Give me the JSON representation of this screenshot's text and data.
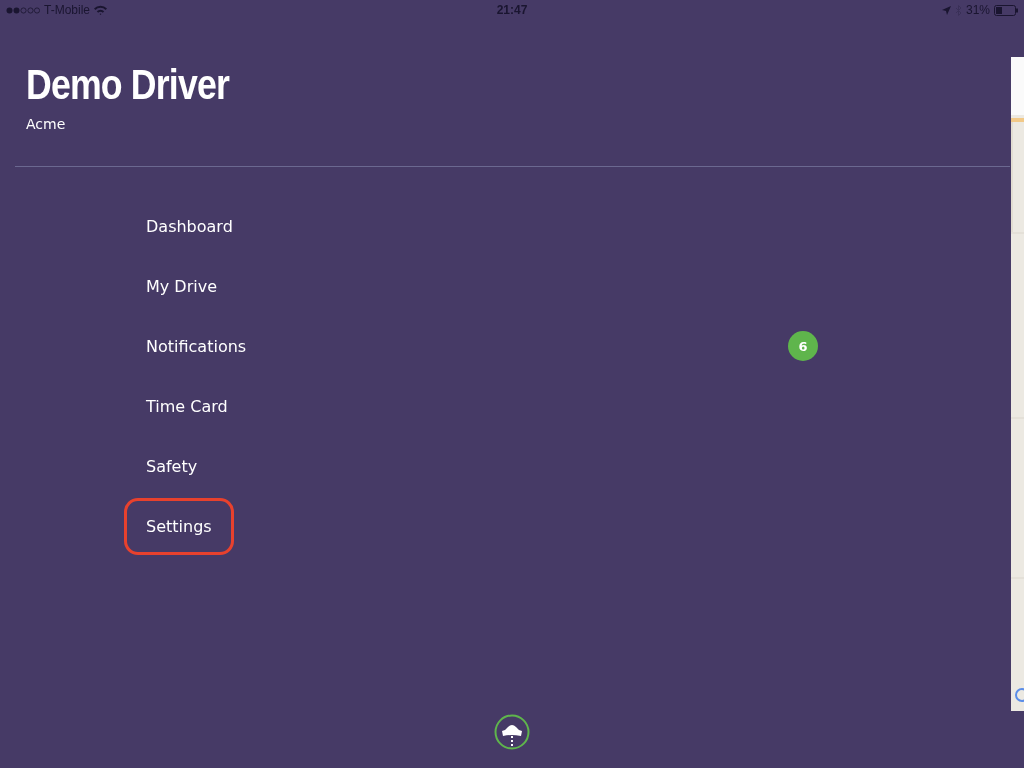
{
  "status_bar": {
    "carrier": "T-Mobile",
    "time": "21:47",
    "battery": "31%"
  },
  "profile": {
    "name": "Demo Driver",
    "company": "Acme"
  },
  "menu": [
    {
      "label": "Dashboard",
      "highlighted": false
    },
    {
      "label": "My Drive",
      "highlighted": false
    },
    {
      "label": "Notifications",
      "highlighted": false,
      "badge": "6"
    },
    {
      "label": "Time Card",
      "highlighted": false
    },
    {
      "label": "Safety",
      "highlighted": false
    },
    {
      "label": "Settings",
      "highlighted": true
    }
  ]
}
